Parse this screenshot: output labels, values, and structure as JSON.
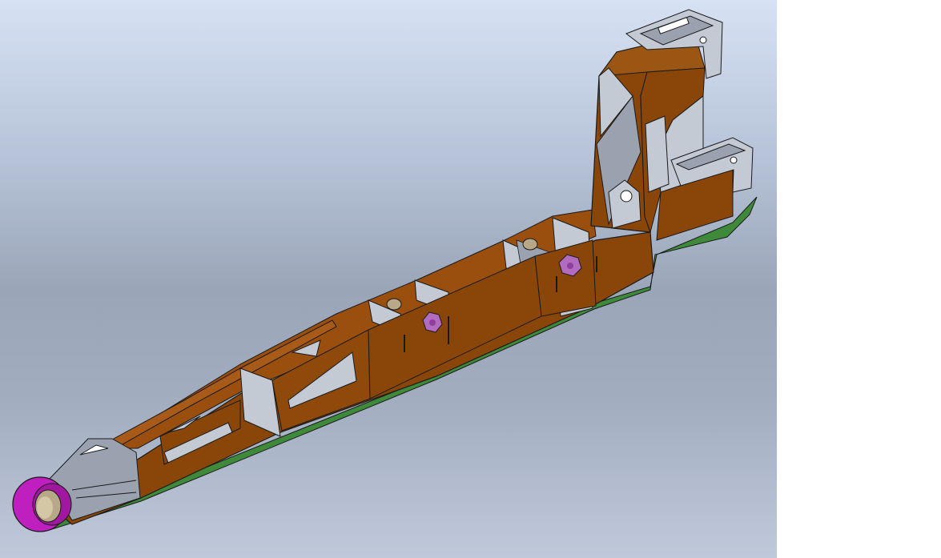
{
  "viewport": {
    "background_top": "#d6e1f4",
    "background_bottom": "#bfc9da"
  },
  "model": {
    "colors": {
      "body": "#8a4608",
      "body_dark": "#6e3806",
      "body_light": "#9b5614",
      "bracket": "#9aa2b0",
      "bracket_light": "#c4cad4",
      "base_plate": "#3f8a3a",
      "bushing": "#c01fc0",
      "bushing_inner": "#b8a888",
      "nut": "#b26bbf",
      "outline": "#1a1a1a"
    }
  }
}
